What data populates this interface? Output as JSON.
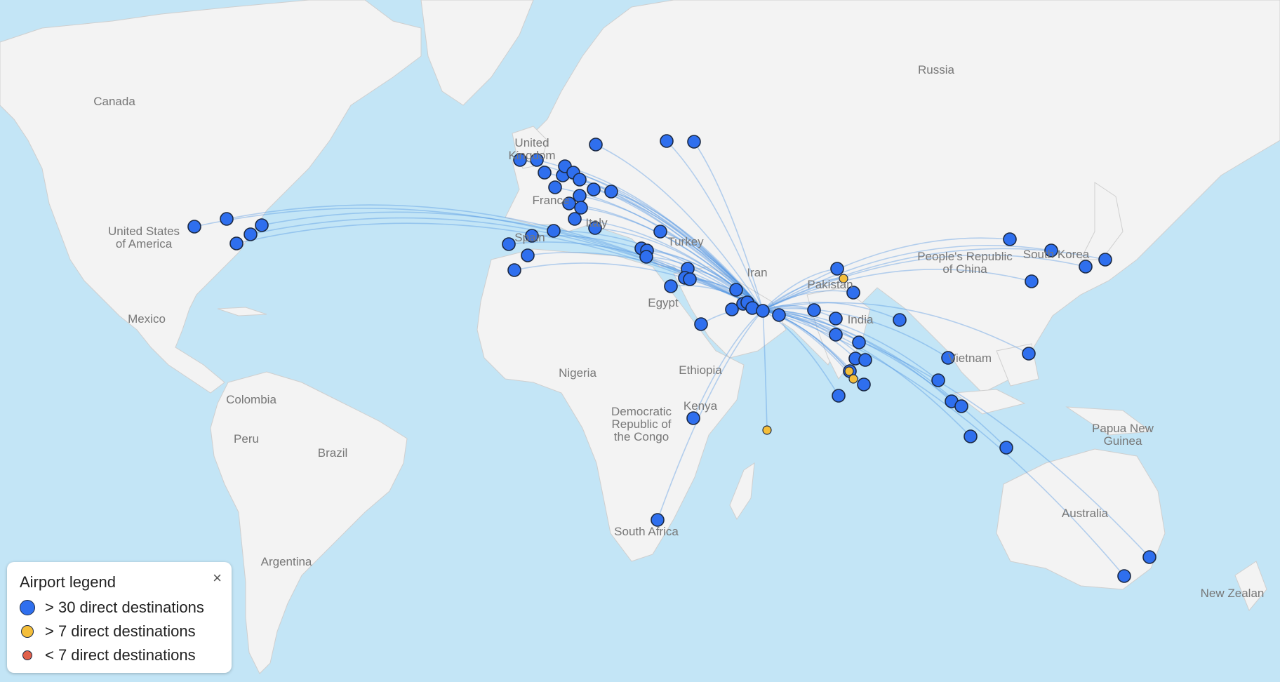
{
  "map": {
    "labels": {
      "canada": "Canada",
      "usa1": "United States",
      "usa2": "of America",
      "mexico": "Mexico",
      "colombia": "Colombia",
      "peru": "Peru",
      "brazil": "Brazil",
      "argentina": "Argentina",
      "uk1": "United",
      "uk2": "Kingdom",
      "france": "France",
      "spain": "Spain",
      "italy": "Italy",
      "turkey": "Turkey",
      "iran": "Iran",
      "pakistan": "Pakistan",
      "india": "India",
      "egypt": "Egypt",
      "nigeria": "Nigeria",
      "ethiopia": "Ethiopia",
      "kenya": "Kenya",
      "drc1": "Democratic",
      "drc2": "Republic of",
      "drc3": "the Congo",
      "south_africa": "South Africa",
      "russia": "Russia",
      "china1": "People's Republic",
      "china2": "of China",
      "south_korea": "South Korea",
      "vietnam": "Vietnam",
      "png1": "Papua New",
      "png2": "Guinea",
      "australia": "Australia",
      "new_zealand": "New Zealan"
    },
    "colors": {
      "water": "#c3e5f6",
      "land": "#f3f3f3",
      "route": "#4a90e2",
      "high": "#2f6fee",
      "mid": "#f4be3a",
      "low": "#e0604a"
    }
  },
  "legend": {
    "title": "Airport legend",
    "close_label": "×",
    "items": [
      {
        "label": "> 30 direct destinations",
        "color": "#2f6fee",
        "category": "high"
      },
      {
        "label": "> 7 direct destinations",
        "color": "#f4be3a",
        "category": "mid"
      },
      {
        "label": "< 7 direct destinations",
        "color": "#e0604a",
        "category": "low"
      }
    ]
  }
}
